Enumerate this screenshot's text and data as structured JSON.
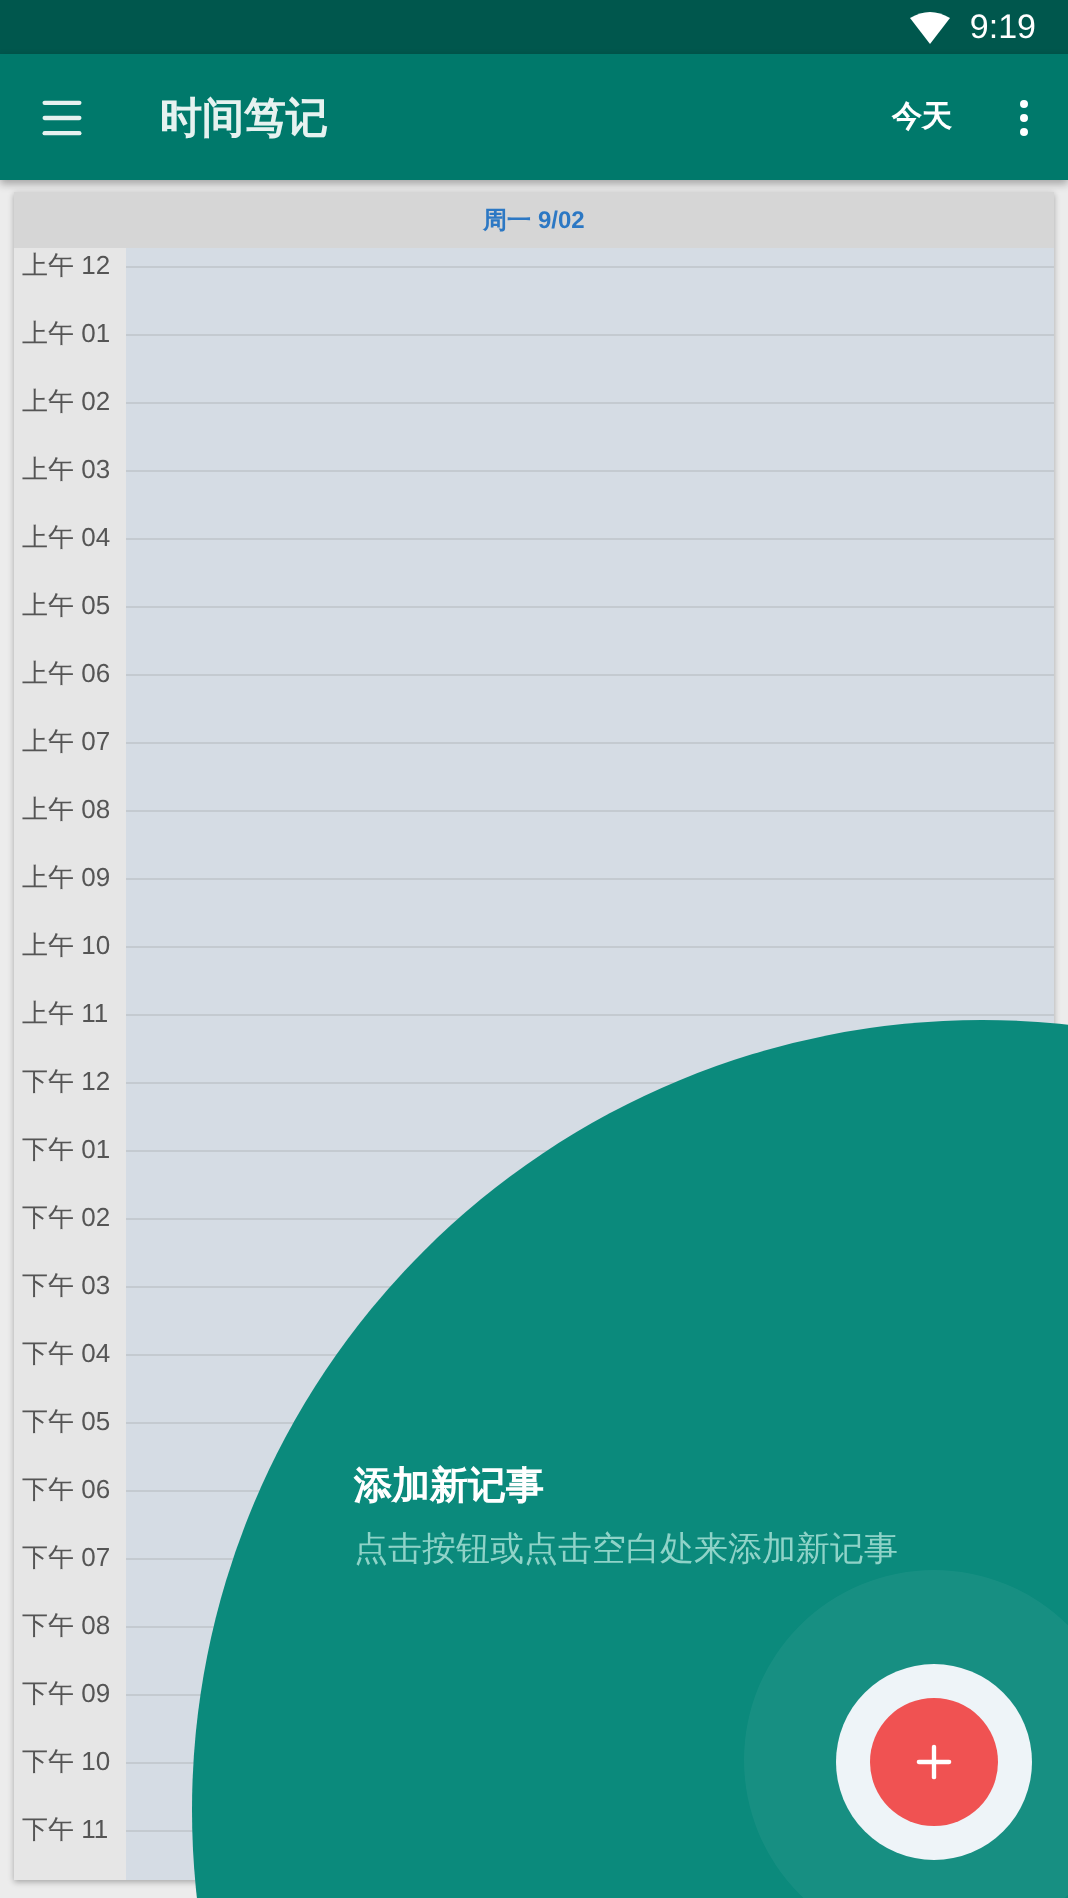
{
  "status_bar": {
    "time": "9:19"
  },
  "app_bar": {
    "title": "时间笃记",
    "today_button": "今天"
  },
  "calendar": {
    "day_header": "周一 9/02",
    "hours": [
      "上午 12",
      "上午 01",
      "上午 02",
      "上午 03",
      "上午 04",
      "上午 05",
      "上午 06",
      "上午 07",
      "上午 08",
      "上午 09",
      "上午 10",
      "上午 11",
      "下午 12",
      "下午 01",
      "下午 02",
      "下午 03",
      "下午 04",
      "下午 05",
      "下午 06",
      "下午 07",
      "下午 08",
      "下午 09",
      "下午 10",
      "下午 11"
    ]
  },
  "tutorial": {
    "title": "添加新记事",
    "text": "点击按钮或点击空白处来添加新记事"
  }
}
